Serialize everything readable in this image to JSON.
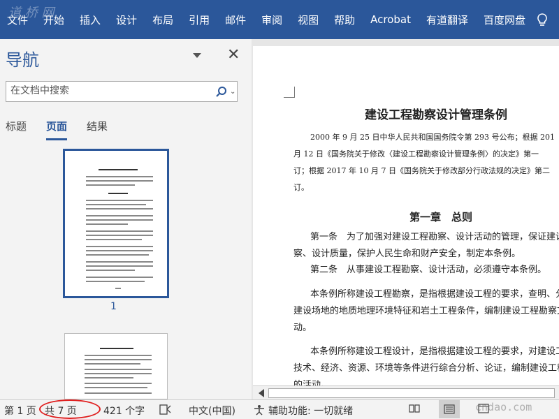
{
  "watermark_top": "道 桥 网",
  "ribbon": {
    "tabs": [
      "文件",
      "开始",
      "插入",
      "设计",
      "布局",
      "引用",
      "邮件",
      "审阅",
      "视图",
      "帮助",
      "Acrobat",
      "有道翻译",
      "百度网盘"
    ]
  },
  "nav": {
    "title": "导航",
    "search_placeholder": "在文档中搜索",
    "tabs": [
      "标题",
      "页面",
      "结果"
    ],
    "active_tab": 1,
    "page_label": "1"
  },
  "document": {
    "title": "建设工程勘察设计管理条例",
    "lines": [
      "2000 年 9 月 25 日中华人民共和国国务院令第 293 号公布；根据 201",
      "月 12 日《国务院关于修改〈建设工程勘察设计管理条例〉的决定》第一",
      "订；根据 2017 年 10 月 7 日《国务院关于修改部分行政法规的决定》第二",
      "订。"
    ],
    "chapter": "第一章　总则",
    "articles": [
      "第一条　为了加强对建设工程勘察、设计活动的管理，保证建设工程",
      "察、设计质量，保护人民生命和财产安全，制定本条例。",
      "第二条　从事建设工程勘察、设计活动，必须遵守本条例。",
      "本条例所称建设工程勘察，是指根据建设工程的要求，查明、分析",
      "建设场地的地质地理环境特征和岩土工程条件，编制建设工程勘察文件的",
      "动。",
      "本条例所称建设工程设计，是指根据建设工程的要求，对建设工程所",
      "技术、经济、资源、环境等条件进行综合分析、论证，编制建设工程设计",
      "的活动。"
    ]
  },
  "status": {
    "page": "第 1 页",
    "total": "共 7 页",
    "words": "421 个字",
    "language": "中文(中国)",
    "accessibility": "辅助功能: 一切就绪"
  },
  "watermark_bottom": "cndao.com"
}
